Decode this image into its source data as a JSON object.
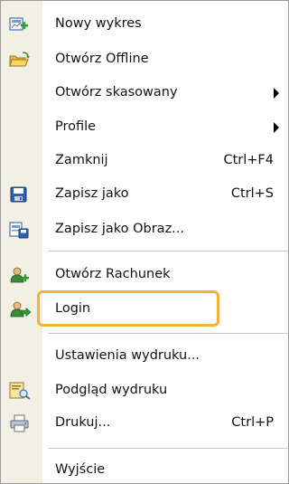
{
  "menu": {
    "items": [
      {
        "label": "Nowy wykres",
        "icon": "new-chart-icon"
      },
      {
        "label": "Otwórz Offline",
        "icon": "open-folder-icon"
      },
      {
        "label": "Otwórz skasowany",
        "icon": "",
        "submenu": true
      },
      {
        "label": "Profile",
        "icon": "",
        "submenu": true
      },
      {
        "label": "Zamknij",
        "icon": "",
        "shortcut": "Ctrl+F4"
      },
      {
        "label": "Zapisz jako",
        "icon": "save-icon",
        "shortcut": "Ctrl+S"
      },
      {
        "label": "Zapisz jako Obraz...",
        "icon": "save-image-icon"
      },
      {
        "label": "Otwórz Rachunek",
        "icon": "open-account-icon"
      },
      {
        "label": "Login",
        "icon": "login-icon",
        "highlighted": true
      },
      {
        "label": "Ustawienia wydruku...",
        "icon": ""
      },
      {
        "label": "Podgląd wydruku",
        "icon": "print-preview-icon"
      },
      {
        "label": "Drukuj...",
        "icon": "printer-icon",
        "shortcut": "Ctrl+P"
      },
      {
        "label": "Wyjście",
        "icon": ""
      }
    ]
  },
  "colors": {
    "gutter": "#f2efe4",
    "highlight_border": "#f2b23a"
  }
}
